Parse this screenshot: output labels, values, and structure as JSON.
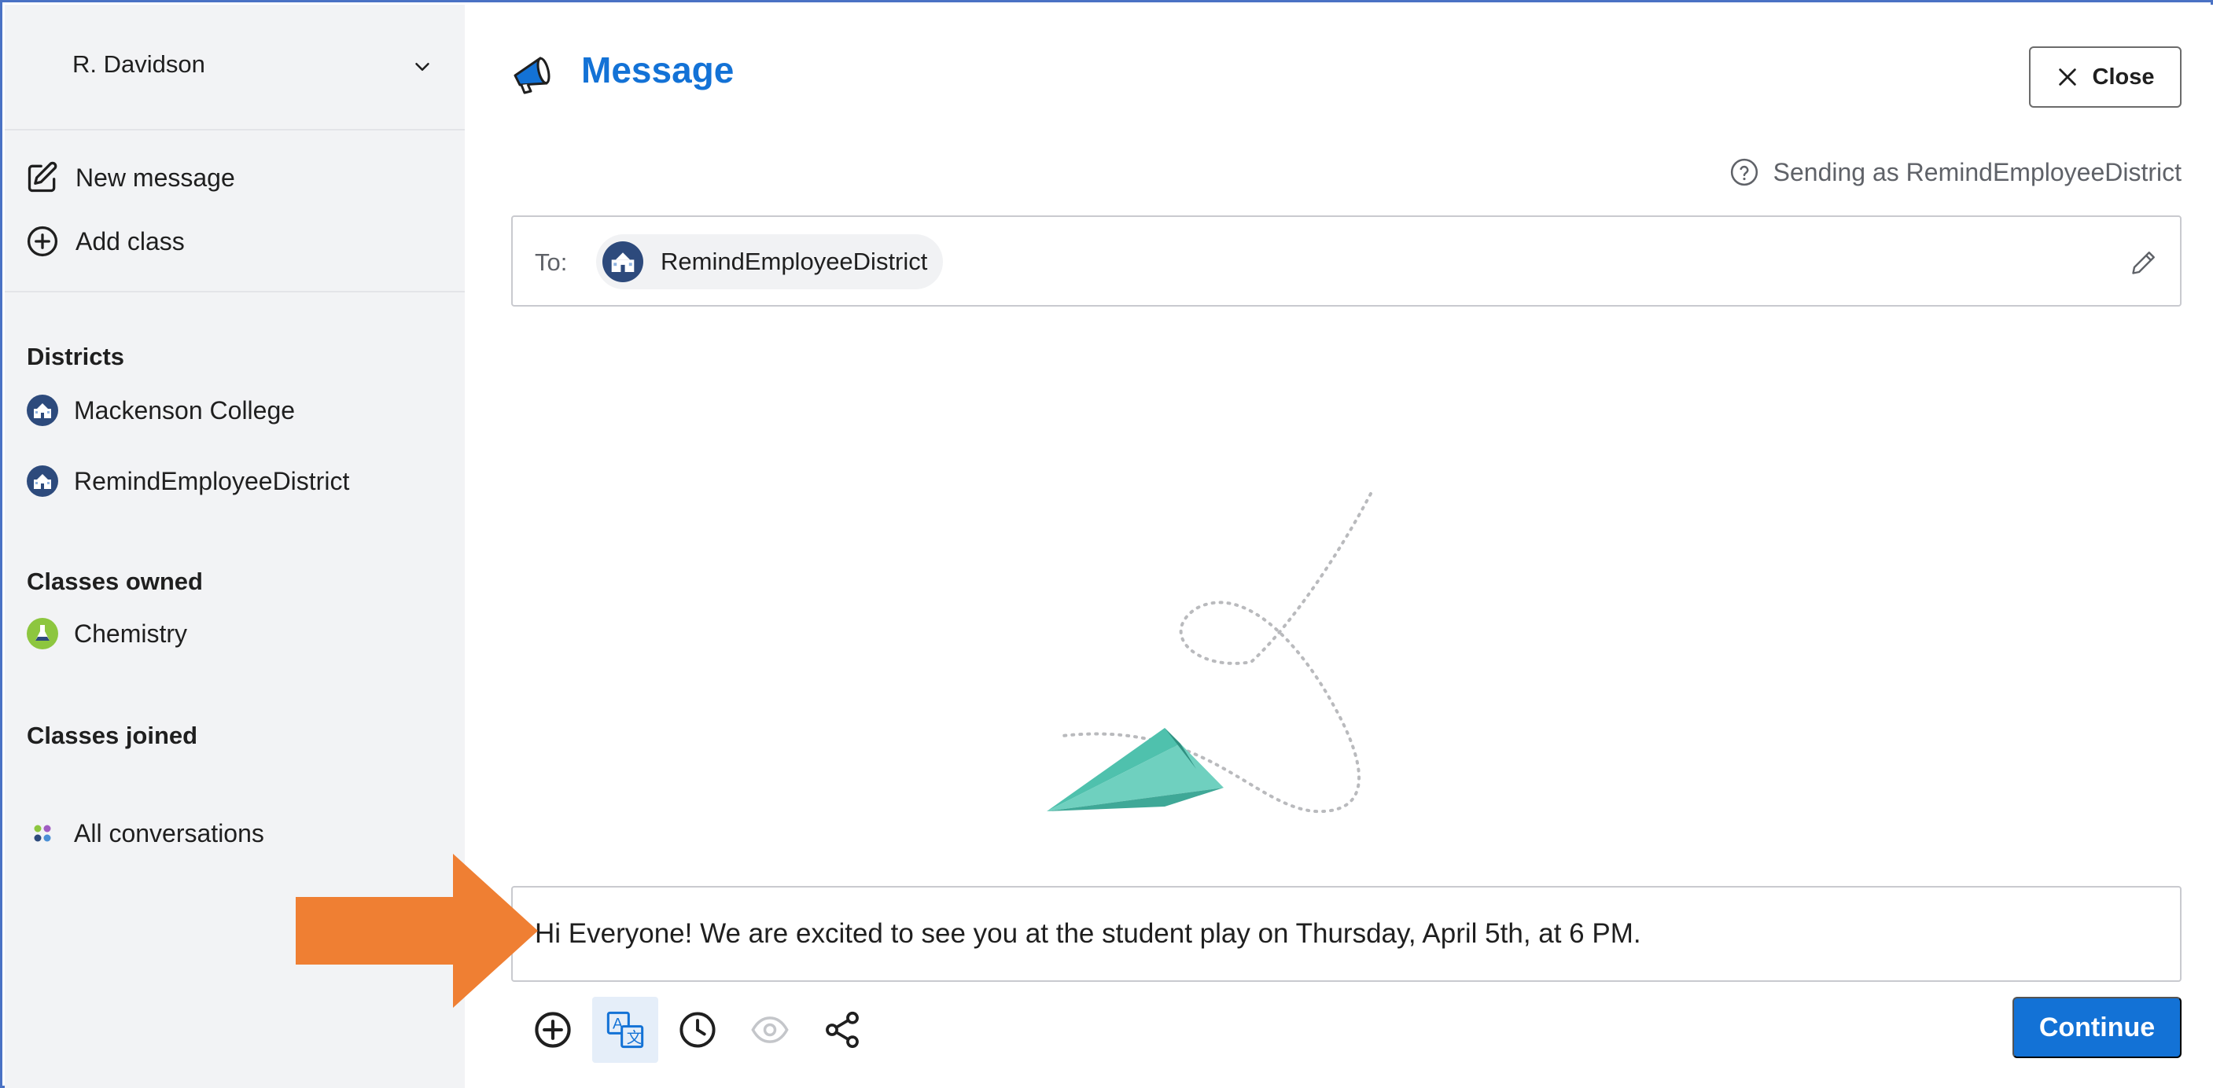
{
  "sidebar": {
    "account_name": "R. Davidson",
    "actions": [
      {
        "label": "New message",
        "icon": "compose-icon"
      },
      {
        "label": "Add class",
        "icon": "plus-circle-icon"
      }
    ],
    "districts_title": "Districts",
    "districts": [
      {
        "label": "Mackenson College",
        "icon": "school-building-icon"
      },
      {
        "label": "RemindEmployeeDistrict",
        "icon": "school-building-icon"
      }
    ],
    "classes_owned_title": "Classes owned",
    "classes_owned": [
      {
        "label": "Chemistry",
        "icon": "flask-icon",
        "color": "#8dc63f"
      }
    ],
    "classes_joined_title": "Classes joined",
    "all_conversations": "All conversations"
  },
  "main": {
    "title": "Message",
    "close_label": "Close",
    "sending_as": "Sending as RemindEmployeeDistrict",
    "to_label": "To:",
    "recipient": "RemindEmployeeDistrict",
    "message_text": "Hi Everyone! We are excited to see you at the student play on Thursday, April 5th, at 6 PM.",
    "continue_label": "Continue",
    "toolbar": [
      "add-attachment-icon",
      "translate-icon",
      "schedule-clock-icon",
      "preview-eye-icon",
      "share-icon"
    ]
  },
  "colors": {
    "accent": "#1372d6",
    "sidebar_bg": "#f2f3f5",
    "arrow": "#ef7f33",
    "plane": "#4fc1ad",
    "district_badge": "#2d4a7c"
  }
}
